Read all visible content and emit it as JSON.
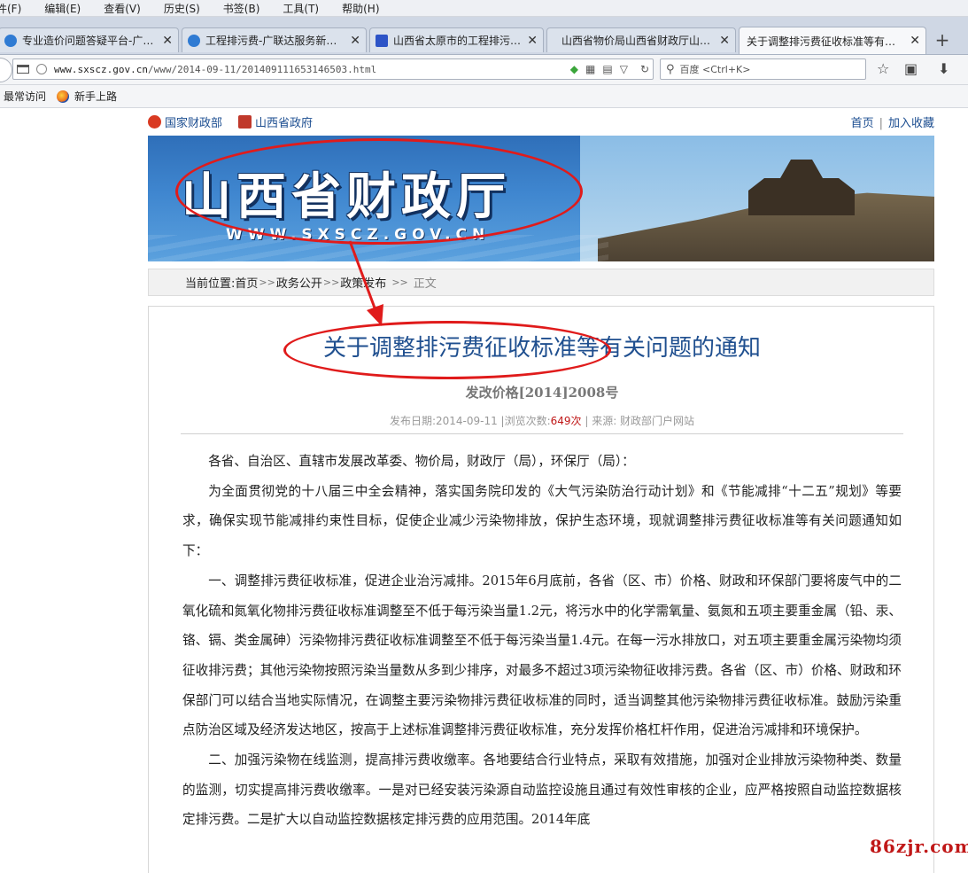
{
  "menubar": [
    "件(F)",
    "编辑(E)",
    "查看(V)",
    "历史(S)",
    "书签(B)",
    "工具(T)",
    "帮助(H)"
  ],
  "tabs": [
    {
      "label": "专业造价问题答疑平台-广…",
      "close": "✕",
      "color": "#2f7bd3"
    },
    {
      "label": "工程排污费-广联达服务新…",
      "close": "✕",
      "color": "#2f7bd3"
    },
    {
      "label": "山西省太原市的工程排污…",
      "close": "✕",
      "color": "#2d54c7"
    },
    {
      "label": "山西省物价局山西省财政厅山…",
      "close": "✕",
      "color": ""
    },
    {
      "label": "关于调整排污费征收标准等有…",
      "close": "✕",
      "color": ""
    }
  ],
  "new_tab": "+",
  "url": {
    "host": "www.sxscz.gov.cn",
    "path": "/www/2014-09-11/201409111653146503.html"
  },
  "search": {
    "placeholder": "百度 <Ctrl+K>"
  },
  "bookmarks": [
    "最常访问",
    "新手上路"
  ],
  "site": {
    "top_left_1": "国家财政部",
    "top_left_2": "山西省政府",
    "home": "首页",
    "sep": "|",
    "favorite": "加入收藏",
    "banner_title": "山西省财政厅",
    "banner_url": "WWW.SXSCZ.GOV.CN"
  },
  "breadcrumb": {
    "prefix": "当前位置:",
    "items": [
      "首页",
      "政务公开",
      "政策发布"
    ],
    "sep": ">>",
    "sep_last": ">>",
    "current": "正文"
  },
  "article": {
    "title": "关于调整排污费征收标准等有关问题的通知",
    "doc_no": "发改价格[2014]2008号",
    "meta_date": "发布日期:2014-09-11 |浏览次数:",
    "meta_views": "649次",
    "meta_source": " | 来源: 财政部门户网站",
    "paragraphs": [
      "各省、自治区、直辖市发展改革委、物价局，财政厅（局），环保厅（局）：",
      "为全面贯彻党的十八届三中全会精神，落实国务院印发的《大气污染防治行动计划》和《节能减排“十二五”规划》等要求，确保实现节能减排约束性目标，促使企业减少污染物排放，保护生态环境，现就调整排污费征收标准等有关问题通知如下：",
      "一、调整排污费征收标准，促进企业治污减排。2015年6月底前，各省（区、市）价格、财政和环保部门要将废气中的二氧化硫和氮氧化物排污费征收标准调整至不低于每污染当量1.2元，将污水中的化学需氧量、氨氮和五项主要重金属（铅、汞、铬、镉、类金属砷）污染物排污费征收标准调整至不低于每污染当量1.4元。在每一污水排放口，对五项主要重金属污染物均须征收排污费；其他污染物按照污染当量数从多到少排序，对最多不超过3项污染物征收排污费。各省（区、市）价格、财政和环保部门可以结合当地实际情况，在调整主要污染物排污费征收标准的同时，适当调整其他污染物排污费征收标准。鼓励污染重点防治区域及经济发达地区，按高于上述标准调整排污费征收标准，充分发挥价格杠杆作用，促进治污减排和环境保护。",
      "二、加强污染物在线监测，提高排污费收缴率。各地要结合行业特点，采取有效措施，加强对企业排放污染物种类、数量的监测，切实提高排污费收缴率。一是对已经安装污染源自动监控设施且通过有效性审核的企业，应严格按照自动监控数据核定排污费。二是扩大以自动监控数据核定排污费的应用范围。2014年底"
    ]
  },
  "watermark": "86zjr.com",
  "colors": {
    "accent": "#1f4f8f",
    "annotation": "#e01b1b",
    "views": "#c01818"
  }
}
